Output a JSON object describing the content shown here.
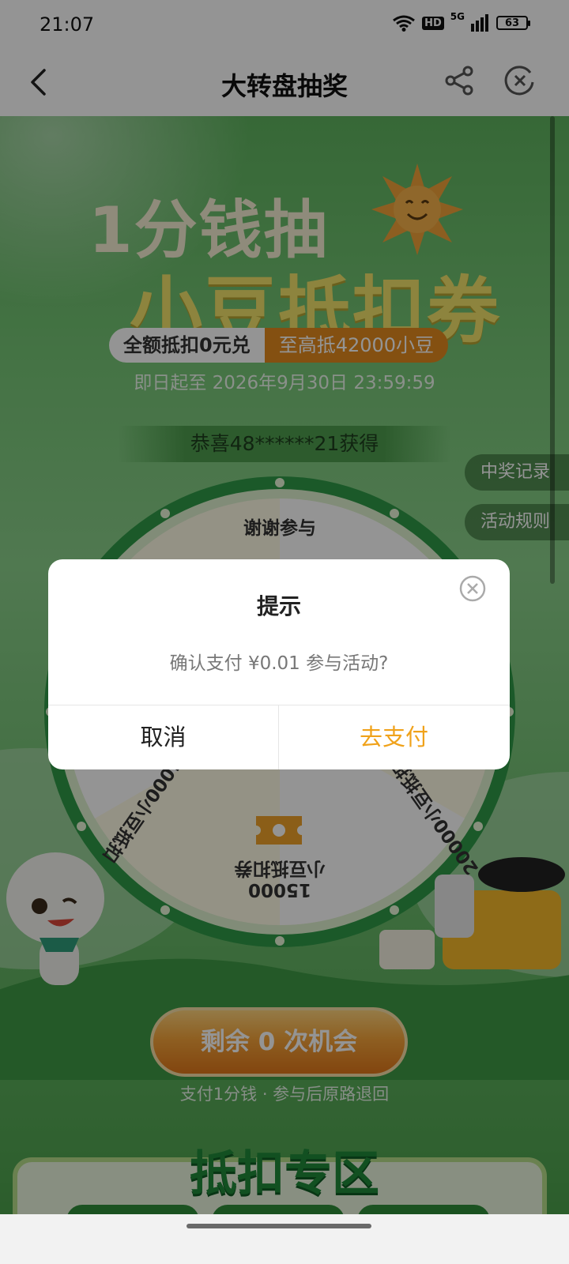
{
  "status_bar": {
    "time": "21:07",
    "network": "5G",
    "hd": "HD",
    "battery": "63"
  },
  "header": {
    "title": "大转盘抽奖"
  },
  "banner": {
    "line1": "1分钱抽",
    "line2": "小豆抵扣券",
    "pill_left": "全额抵扣0元兑",
    "pill_right": "至高抵42000小豆",
    "date": "即日起至 2026年9月30日 23:59:59"
  },
  "marquee": "恭喜48******21获得",
  "side_buttons": {
    "records": "中奖记录",
    "rules": "活动规则"
  },
  "wheel": {
    "top_label": "谢谢参与",
    "left_label": "4000小豆抵扣",
    "right_label": "20000小豆抵扣券",
    "bottom_line1": "15000",
    "bottom_line2": "小豆抵扣券"
  },
  "cta": {
    "label": "剩余 0 次机会",
    "subtext": "支付1分钱 · 参与后原路退回"
  },
  "zone": {
    "title": "抵扣专区"
  },
  "dialog": {
    "title": "提示",
    "message": "确认支付 ¥0.01 参与活动?",
    "cancel": "取消",
    "confirm": "去支付"
  },
  "colors": {
    "accent": "#f0a21a",
    "green": "#4aa04a",
    "orange": "#e48b1e"
  }
}
